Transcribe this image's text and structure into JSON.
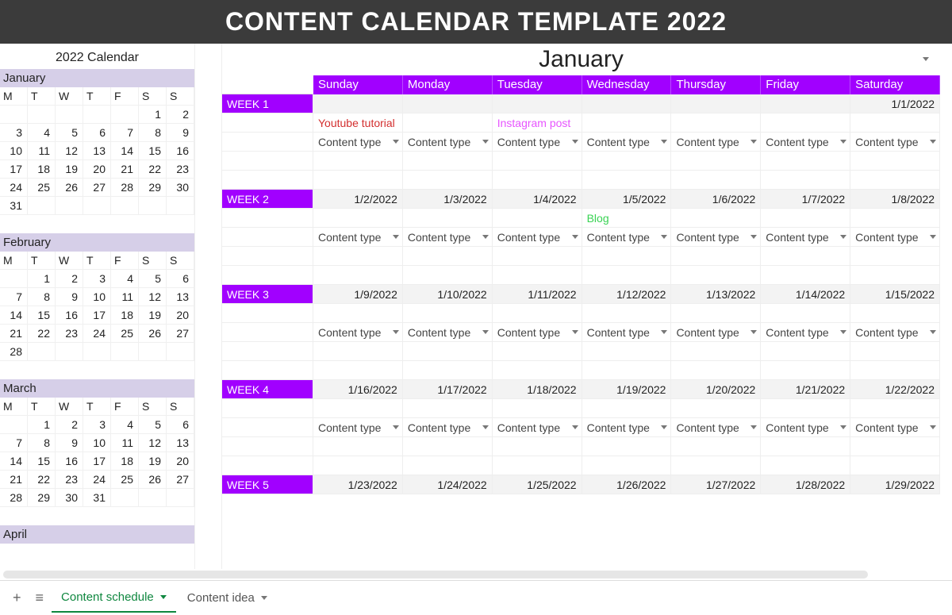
{
  "title": "CONTENT CALENDAR TEMPLATE 2022",
  "sidebar": {
    "title": "2022 Calendar",
    "dow": [
      "M",
      "T",
      "W",
      "T",
      "F",
      "S",
      "S"
    ],
    "months": [
      {
        "name": "January",
        "offset": 5,
        "days": 31
      },
      {
        "name": "February",
        "offset": 1,
        "days": 28
      },
      {
        "name": "March",
        "offset": 1,
        "days": 31
      },
      {
        "name": "April",
        "offset": 4,
        "days": 0
      }
    ]
  },
  "month_selector": {
    "label": "January"
  },
  "day_headers": [
    "Sunday",
    "Monday",
    "Tuesday",
    "Wednesday",
    "Thursday",
    "Friday",
    "Saturday"
  ],
  "content_type_label": "Content type",
  "weeks": [
    {
      "label": "WEEK 1",
      "dates": [
        "",
        "",
        "",
        "",
        "",
        "",
        "1/1/2022"
      ],
      "ideas": [
        {
          "text": "Youtube tutorial",
          "color": "red"
        },
        {
          "text": "",
          "color": ""
        },
        {
          "text": "Instagram post",
          "color": "pink"
        },
        {
          "text": "",
          "color": ""
        },
        {
          "text": "",
          "color": ""
        },
        {
          "text": "",
          "color": ""
        },
        {
          "text": "",
          "color": ""
        }
      ]
    },
    {
      "label": "WEEK 2",
      "dates": [
        "1/2/2022",
        "1/3/2022",
        "1/4/2022",
        "1/5/2022",
        "1/6/2022",
        "1/7/2022",
        "1/8/2022"
      ],
      "ideas": [
        {
          "text": "",
          "color": ""
        },
        {
          "text": "",
          "color": ""
        },
        {
          "text": "",
          "color": ""
        },
        {
          "text": "Blog",
          "color": "green"
        },
        {
          "text": "",
          "color": ""
        },
        {
          "text": "",
          "color": ""
        },
        {
          "text": "",
          "color": ""
        }
      ]
    },
    {
      "label": "WEEK 3",
      "dates": [
        "1/9/2022",
        "1/10/2022",
        "1/11/2022",
        "1/12/2022",
        "1/13/2022",
        "1/14/2022",
        "1/15/2022"
      ],
      "ideas": [
        {
          "text": "",
          "color": ""
        },
        {
          "text": "",
          "color": ""
        },
        {
          "text": "",
          "color": ""
        },
        {
          "text": "",
          "color": ""
        },
        {
          "text": "",
          "color": ""
        },
        {
          "text": "",
          "color": ""
        },
        {
          "text": "",
          "color": ""
        }
      ]
    },
    {
      "label": "WEEK 4",
      "dates": [
        "1/16/2022",
        "1/17/2022",
        "1/18/2022",
        "1/19/2022",
        "1/20/2022",
        "1/21/2022",
        "1/22/2022"
      ],
      "ideas": [
        {
          "text": "",
          "color": ""
        },
        {
          "text": "",
          "color": ""
        },
        {
          "text": "",
          "color": ""
        },
        {
          "text": "",
          "color": ""
        },
        {
          "text": "",
          "color": ""
        },
        {
          "text": "",
          "color": ""
        },
        {
          "text": "",
          "color": ""
        }
      ]
    },
    {
      "label": "WEEK 5",
      "dates": [
        "1/23/2022",
        "1/24/2022",
        "1/25/2022",
        "1/26/2022",
        "1/27/2022",
        "1/28/2022",
        "1/29/2022"
      ],
      "ideas": null
    }
  ],
  "tabs": {
    "active": "Content schedule",
    "inactive": "Content idea"
  }
}
